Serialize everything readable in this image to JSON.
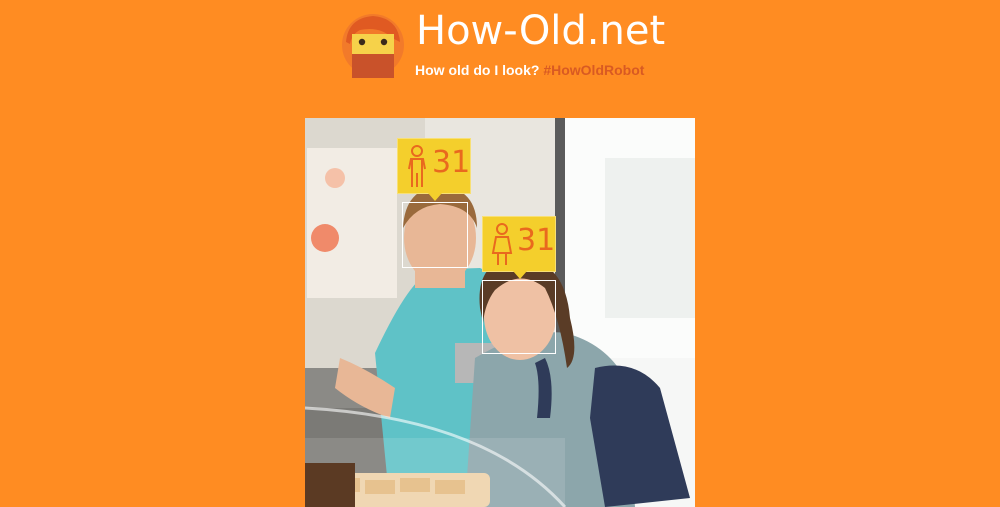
{
  "header": {
    "title": "How-Old.net",
    "tagline": "How old do I look?",
    "hashtag": "#HowOldRobot"
  },
  "faces": [
    {
      "age": "31",
      "gender_icon": "person-icon"
    },
    {
      "age": "31",
      "gender_icon": "person-female-icon"
    }
  ],
  "colors": {
    "background": "#ff8c22",
    "tag_yellow": "#f4cf2c",
    "accent": "#d95a22"
  },
  "logo_icon": "robot-face-icon"
}
